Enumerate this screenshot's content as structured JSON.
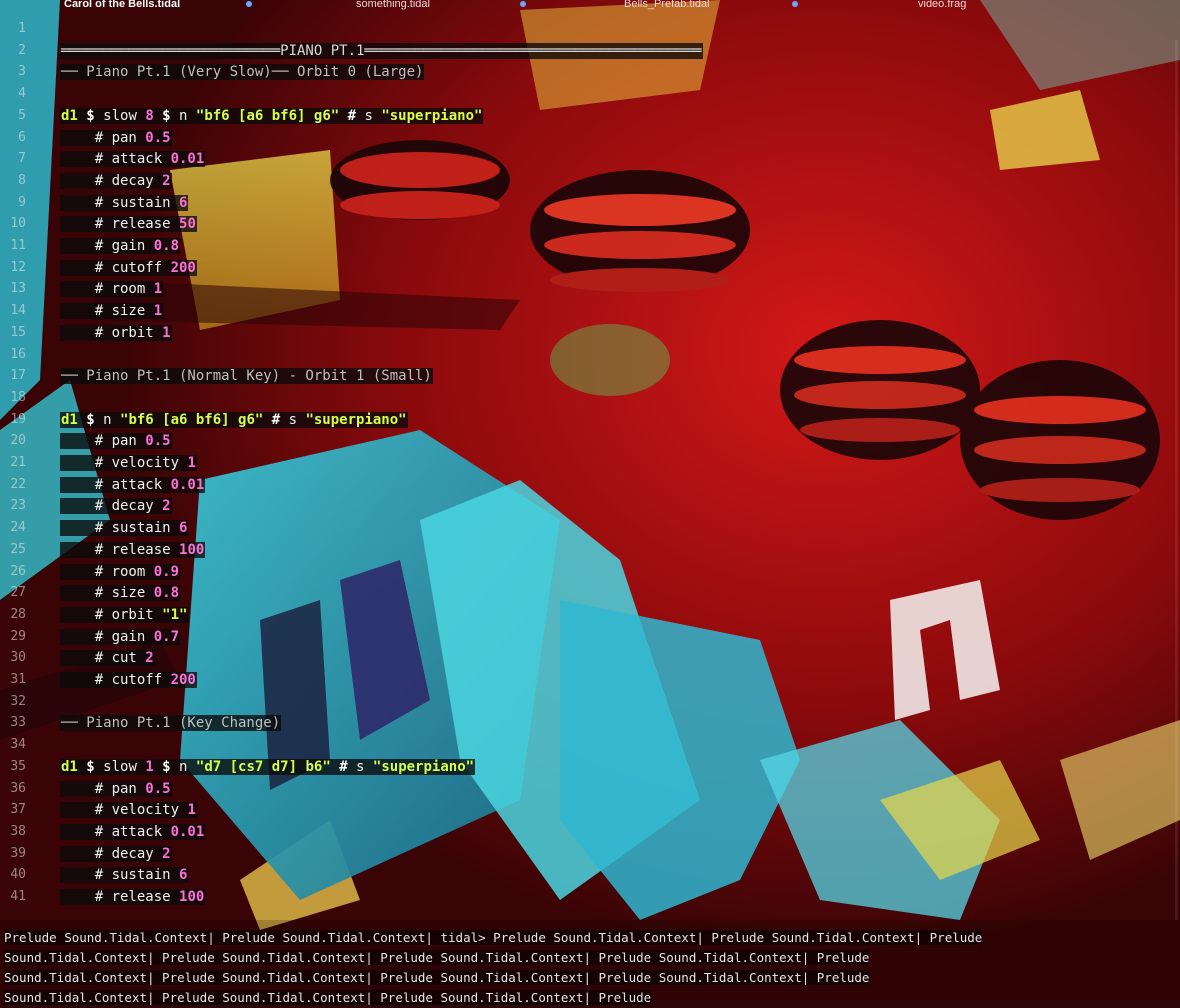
{
  "tabs": [
    {
      "label": "Carol of the Bells.tidal",
      "active": true
    },
    {
      "label": "something.tidal",
      "active": false
    },
    {
      "label": "Bells_Prefab.tidal",
      "active": false
    },
    {
      "label": "video.frag",
      "active": false
    }
  ],
  "lines": [
    {
      "n": "1",
      "segs": []
    },
    {
      "n": "2",
      "segs": [
        {
          "c": "sep",
          "t": "══════════════════════════PIANO PT.1════════════════════════════════════════"
        }
      ]
    },
    {
      "n": "3",
      "segs": [
        {
          "c": "cm",
          "t": "── Piano Pt.1 (Very Slow)── Orbit 0 (Large)"
        }
      ]
    },
    {
      "n": "4",
      "segs": []
    },
    {
      "n": "5",
      "segs": [
        {
          "c": "kw",
          "t": "d1 "
        },
        {
          "c": "op",
          "t": "$ "
        },
        {
          "c": "tx",
          "t": "slow "
        },
        {
          "c": "num",
          "t": "8 "
        },
        {
          "c": "op",
          "t": "$ "
        },
        {
          "c": "tx",
          "t": "n "
        },
        {
          "c": "str",
          "t": "\"bf6 [a6 bf6] g6\" "
        },
        {
          "c": "op",
          "t": "# "
        },
        {
          "c": "tx",
          "t": "s "
        },
        {
          "c": "str",
          "t": "\"superpiano\""
        }
      ]
    },
    {
      "n": "6",
      "segs": [
        {
          "c": "tx",
          "t": "    # pan "
        },
        {
          "c": "num",
          "t": "0.5"
        }
      ]
    },
    {
      "n": "7",
      "segs": [
        {
          "c": "tx",
          "t": "    # attack "
        },
        {
          "c": "num",
          "t": "0.01"
        }
      ]
    },
    {
      "n": "8",
      "segs": [
        {
          "c": "tx",
          "t": "    # decay "
        },
        {
          "c": "num",
          "t": "2"
        }
      ]
    },
    {
      "n": "9",
      "segs": [
        {
          "c": "tx",
          "t": "    # sustain "
        },
        {
          "c": "num",
          "t": "6"
        }
      ]
    },
    {
      "n": "10",
      "segs": [
        {
          "c": "tx",
          "t": "    # release "
        },
        {
          "c": "num",
          "t": "50"
        }
      ]
    },
    {
      "n": "11",
      "segs": [
        {
          "c": "tx",
          "t": "    # gain "
        },
        {
          "c": "num",
          "t": "0.8"
        }
      ]
    },
    {
      "n": "12",
      "segs": [
        {
          "c": "tx",
          "t": "    # cutoff "
        },
        {
          "c": "num",
          "t": "200"
        }
      ]
    },
    {
      "n": "13",
      "segs": [
        {
          "c": "tx",
          "t": "    # room "
        },
        {
          "c": "num",
          "t": "1"
        }
      ]
    },
    {
      "n": "14",
      "segs": [
        {
          "c": "tx",
          "t": "    # size "
        },
        {
          "c": "num",
          "t": "1"
        }
      ]
    },
    {
      "n": "15",
      "segs": [
        {
          "c": "tx",
          "t": "    # orbit "
        },
        {
          "c": "num",
          "t": "1"
        }
      ]
    },
    {
      "n": "16",
      "segs": []
    },
    {
      "n": "17",
      "segs": [
        {
          "c": "cm",
          "t": "── Piano Pt.1 (Normal Key) - Orbit 1 (Small)"
        }
      ]
    },
    {
      "n": "18",
      "segs": []
    },
    {
      "n": "19",
      "segs": [
        {
          "c": "kw",
          "t": "d1 "
        },
        {
          "c": "op",
          "t": "$ "
        },
        {
          "c": "tx",
          "t": "n "
        },
        {
          "c": "str",
          "t": "\"bf6 [a6 bf6] g6\" "
        },
        {
          "c": "op",
          "t": "# "
        },
        {
          "c": "tx",
          "t": "s "
        },
        {
          "c": "str",
          "t": "\"superpiano\""
        }
      ]
    },
    {
      "n": "20",
      "segs": [
        {
          "c": "tx",
          "t": "    # pan "
        },
        {
          "c": "num",
          "t": "0.5"
        }
      ]
    },
    {
      "n": "21",
      "segs": [
        {
          "c": "tx",
          "t": "    # velocity "
        },
        {
          "c": "num",
          "t": "1"
        }
      ]
    },
    {
      "n": "22",
      "segs": [
        {
          "c": "tx",
          "t": "    # attack "
        },
        {
          "c": "num",
          "t": "0.01"
        }
      ]
    },
    {
      "n": "23",
      "segs": [
        {
          "c": "tx",
          "t": "    # decay "
        },
        {
          "c": "num",
          "t": "2"
        }
      ]
    },
    {
      "n": "24",
      "segs": [
        {
          "c": "tx",
          "t": "    # sustain "
        },
        {
          "c": "num",
          "t": "6"
        }
      ]
    },
    {
      "n": "25",
      "segs": [
        {
          "c": "tx",
          "t": "    # release "
        },
        {
          "c": "num",
          "t": "100"
        }
      ]
    },
    {
      "n": "26",
      "segs": [
        {
          "c": "tx",
          "t": "    # room "
        },
        {
          "c": "num",
          "t": "0.9"
        }
      ]
    },
    {
      "n": "27",
      "segs": [
        {
          "c": "tx",
          "t": "    # size "
        },
        {
          "c": "num",
          "t": "0.8"
        }
      ]
    },
    {
      "n": "28",
      "segs": [
        {
          "c": "tx",
          "t": "    # orbit "
        },
        {
          "c": "str",
          "t": "\"1\""
        }
      ]
    },
    {
      "n": "29",
      "segs": [
        {
          "c": "tx",
          "t": "    # gain "
        },
        {
          "c": "num",
          "t": "0.7"
        }
      ]
    },
    {
      "n": "30",
      "segs": [
        {
          "c": "tx",
          "t": "    # cut "
        },
        {
          "c": "num",
          "t": "2"
        }
      ]
    },
    {
      "n": "31",
      "segs": [
        {
          "c": "tx",
          "t": "    # cutoff "
        },
        {
          "c": "num",
          "t": "200"
        }
      ]
    },
    {
      "n": "32",
      "segs": []
    },
    {
      "n": "33",
      "segs": [
        {
          "c": "cm",
          "t": "── Piano Pt.1 (Key Change)"
        }
      ]
    },
    {
      "n": "34",
      "segs": []
    },
    {
      "n": "35",
      "segs": [
        {
          "c": "kw",
          "t": "d1 "
        },
        {
          "c": "op",
          "t": "$ "
        },
        {
          "c": "tx",
          "t": "slow "
        },
        {
          "c": "num",
          "t": "1 "
        },
        {
          "c": "op",
          "t": "$ "
        },
        {
          "c": "tx",
          "t": "n "
        },
        {
          "c": "str",
          "t": "\"d7 [cs7 d7] b6\" "
        },
        {
          "c": "op",
          "t": "# "
        },
        {
          "c": "tx",
          "t": "s "
        },
        {
          "c": "str",
          "t": "\"superpiano\""
        }
      ]
    },
    {
      "n": "36",
      "segs": [
        {
          "c": "tx",
          "t": "    # pan "
        },
        {
          "c": "num",
          "t": "0.5"
        }
      ]
    },
    {
      "n": "37",
      "segs": [
        {
          "c": "tx",
          "t": "    # velocity "
        },
        {
          "c": "num",
          "t": "1"
        }
      ]
    },
    {
      "n": "38",
      "segs": [
        {
          "c": "tx",
          "t": "    # attack "
        },
        {
          "c": "num",
          "t": "0.01"
        }
      ]
    },
    {
      "n": "39",
      "segs": [
        {
          "c": "tx",
          "t": "    # decay "
        },
        {
          "c": "num",
          "t": "2"
        }
      ]
    },
    {
      "n": "40",
      "segs": [
        {
          "c": "tx",
          "t": "    # sustain "
        },
        {
          "c": "num",
          "t": "6"
        }
      ]
    },
    {
      "n": "41",
      "segs": [
        {
          "c": "tx",
          "t": "    # release "
        },
        {
          "c": "num",
          "t": "100"
        }
      ]
    }
  ],
  "console": [
    "Prelude Sound.Tidal.Context| Prelude Sound.Tidal.Context| tidal> Prelude Sound.Tidal.Context| Prelude Sound.Tidal.Context| Prelude",
    "Sound.Tidal.Context| Prelude Sound.Tidal.Context| Prelude Sound.Tidal.Context| Prelude Sound.Tidal.Context| Prelude",
    "Sound.Tidal.Context| Prelude Sound.Tidal.Context| Prelude Sound.Tidal.Context| Prelude Sound.Tidal.Context| Prelude",
    "Sound.Tidal.Context| Prelude Sound.Tidal.Context| Prelude Sound.Tidal.Context| Prelude"
  ],
  "colors": {
    "keyword": "#d6ff4a",
    "number": "#ff6fd8",
    "string": "#d6ff4a",
    "comment": "#bfbfbf",
    "tab_dot": "#6aa8ff"
  }
}
